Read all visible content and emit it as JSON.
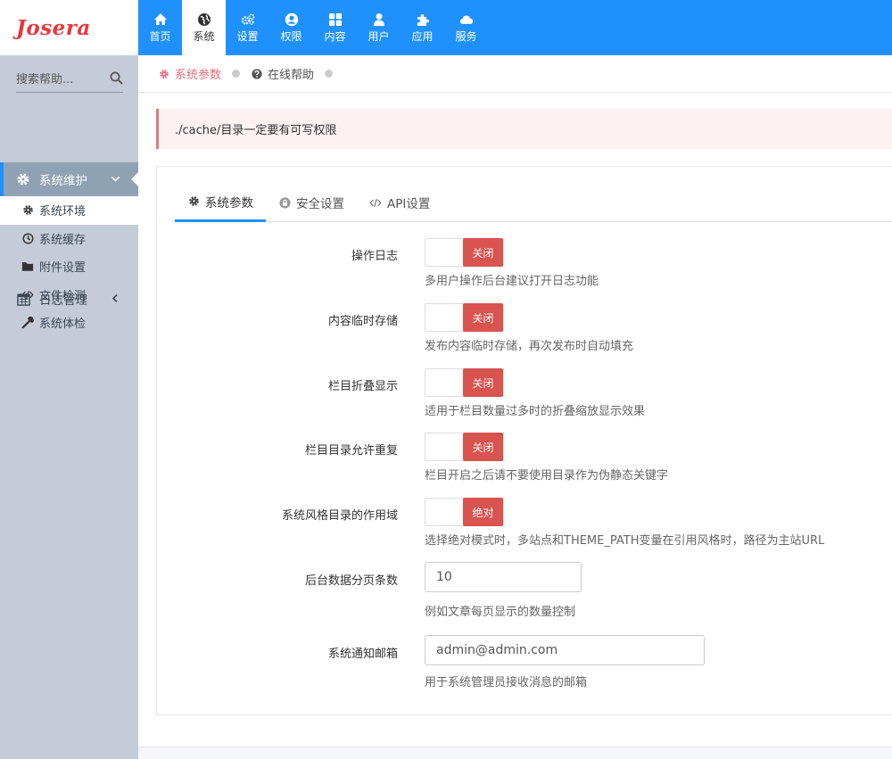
{
  "brand": {
    "logo_text": "Josera"
  },
  "topnav": {
    "items": [
      {
        "label": "首页",
        "icon": "home-icon"
      },
      {
        "label": "系统",
        "icon": "globe-icon",
        "active": true
      },
      {
        "label": "设置",
        "icon": "gears-icon"
      },
      {
        "label": "权限",
        "icon": "user-circle-icon"
      },
      {
        "label": "内容",
        "icon": "grid-icon"
      },
      {
        "label": "用户",
        "icon": "user-icon"
      },
      {
        "label": "应用",
        "icon": "puzzle-icon"
      },
      {
        "label": "服务",
        "icon": "cloud-icon"
      }
    ]
  },
  "sidebar": {
    "search_placeholder": "搜索帮助...",
    "group_maintenance": "系统维护",
    "items": [
      {
        "label": "系统环境",
        "icon": "gear-icon",
        "active": true
      },
      {
        "label": "系统缓存",
        "icon": "clock-icon"
      },
      {
        "label": "附件设置",
        "icon": "folder-icon"
      },
      {
        "label": "文件检测",
        "icon": "code-icon"
      },
      {
        "label": "系统体检",
        "icon": "wrench-icon"
      }
    ],
    "group_logs": "日志管理"
  },
  "breadcrumb": {
    "current": "系统参数",
    "help": "在线帮助"
  },
  "alert": {
    "text": "./cache/目录一定要有可写权限"
  },
  "tabs": [
    {
      "label": "系统参数",
      "icon": "gear-icon",
      "active": true
    },
    {
      "label": "安全设置",
      "icon": "lock-icon"
    },
    {
      "label": "API设置",
      "icon": "code-icon"
    }
  ],
  "form": {
    "op_log": {
      "label": "操作日志",
      "state": "关闭",
      "help": "多用户操作后台建议打开日志功能"
    },
    "temp_storage": {
      "label": "内容临时存储",
      "state": "关闭",
      "help": "发布内容临时存储，再次发布时自动填充"
    },
    "column_fold": {
      "label": "栏目折叠显示",
      "state": "关闭",
      "help": "适用于栏目数量过多时的折叠缩放显示效果"
    },
    "column_dir_dup": {
      "label": "栏目目录允许重复",
      "state": "关闭",
      "help": "栏目开启之后请不要使用目录作为伪静态关键字"
    },
    "theme_scope": {
      "label": "系统风格目录的作用域",
      "state": "绝对",
      "help": "选择绝对模式时，多站点和THEME_PATH变量在引用风格时，路径为主站URL"
    },
    "page_size": {
      "label": "后台数据分页条数",
      "value": "10",
      "help": "例如文章每页显示的数量控制"
    },
    "notify_email": {
      "label": "系统通知邮箱",
      "value": "admin@admin.com",
      "help": "用于系统管理员接收消息的邮箱"
    }
  },
  "colors": {
    "primary": "#1e91ff",
    "danger": "#d9534f",
    "sidebar_bg": "#c4cdd7",
    "accent_text": "#e46a76"
  }
}
